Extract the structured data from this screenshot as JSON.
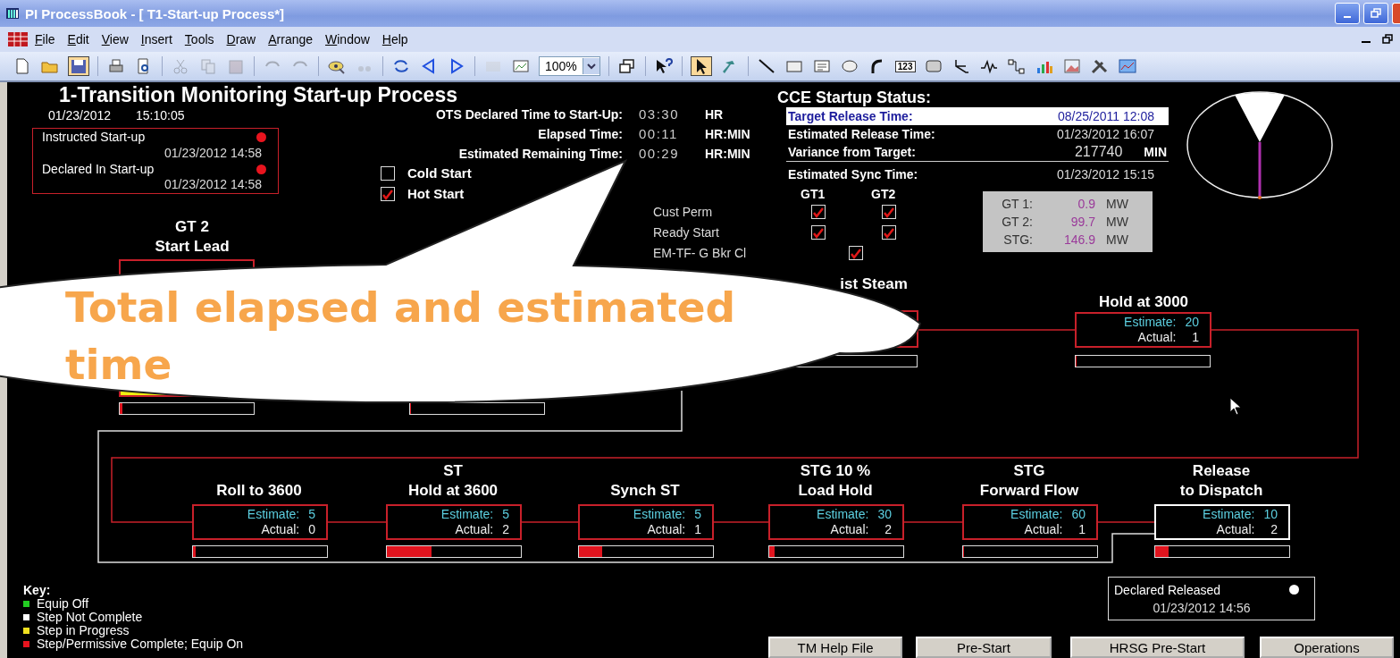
{
  "window": {
    "title": "PI ProcessBook - [ T1-Start-up Process*]"
  },
  "menu": [
    "File",
    "Edit",
    "View",
    "Insert",
    "Tools",
    "Draw",
    "Arrange",
    "Window",
    "Help"
  ],
  "toolbar": {
    "zoom": "100%",
    "number_tool": "123"
  },
  "display": {
    "title": "1-Transition Monitoring Start-up Process",
    "date": "01/23/2012",
    "clock": "15:10:05",
    "events": [
      {
        "label": "Instructed Start-up",
        "time": "01/23/2012 14:58",
        "color": "#e8141e"
      },
      {
        "label": "Declared In Start-up",
        "time": "01/23/2012 14:58",
        "color": "#e8141e"
      }
    ],
    "timings": [
      {
        "label": "OTS Declared Time to Start-Up:",
        "value": "03:30",
        "unit": "HR"
      },
      {
        "label": "Elapsed Time:",
        "value": "00:11",
        "unit": "HR:MIN"
      },
      {
        "label": "Estimated Remaining Time:",
        "value": "00:29",
        "unit": "HR:MIN"
      }
    ],
    "start_modes": [
      {
        "label": "Cold Start",
        "checked": false
      },
      {
        "label": "Hot Start",
        "checked": true
      }
    ],
    "cce": {
      "title": "CCE Startup Status:",
      "rows": [
        {
          "label": "Target Release Time:",
          "value": "08/25/2011 12:08",
          "selected": true
        },
        {
          "label": "Estimated Release Time:",
          "value": "01/23/2012 16:07",
          "selected": false
        },
        {
          "label": "Variance from Target:",
          "value": "217740",
          "unit": "MIN",
          "selected": false
        },
        {
          "label": "Estimated Sync Time:",
          "value": "01/23/2012 15:15",
          "selected": false
        }
      ]
    },
    "permissives": {
      "columns": [
        "GT1",
        "GT2"
      ],
      "rows": [
        {
          "label": "Cust Perm",
          "checks": [
            {
              "checked": true
            },
            {
              "checked": true
            }
          ]
        },
        {
          "label": "Ready Start",
          "checks": [
            {
              "checked": true
            },
            {
              "checked": true
            }
          ]
        },
        {
          "label": "EM-TF- G Bkr Cl",
          "checks": [
            {
              "checked": true
            }
          ]
        }
      ]
    },
    "power": [
      {
        "label": "GT 1:",
        "value": "0.9",
        "unit": "MW"
      },
      {
        "label": "GT 2:",
        "value": "99.7",
        "unit": "MW"
      },
      {
        "label": "STG:",
        "value": "146.9",
        "unit": "MW"
      }
    ],
    "top_steps": [
      {
        "title_lines": [
          "GT 2",
          "Start Lead"
        ],
        "color": "#c8202a",
        "in_progress": true,
        "level": 0.02
      },
      {
        "level": 0
      },
      {
        "title_lines": [
          "ist Steam"
        ],
        "color": "#c8202a",
        "in_progress": false,
        "level": 0
      },
      {
        "title_lines": [
          "Hold at 3000"
        ],
        "color": "#c8202a",
        "in_progress": false,
        "estimate_label": "Estimate:",
        "estimate": "20",
        "actual_label": "Actual:",
        "actual": "1",
        "level": 0
      }
    ],
    "bottom_steps": [
      {
        "title_lines": [
          "Roll to 3600"
        ],
        "color": "#c8202a",
        "in_progress": false,
        "estimate_label": "Estimate:",
        "estimate": "5",
        "actual_label": "Actual:",
        "actual": "0",
        "level": 0.02
      },
      {
        "title_lines": [
          "ST",
          "Hold at 3600"
        ],
        "color": "#c8202a",
        "in_progress": false,
        "estimate_label": "Estimate:",
        "estimate": "5",
        "actual_label": "Actual:",
        "actual": "2",
        "level": 0.33
      },
      {
        "title_lines": [
          "Synch ST"
        ],
        "color": "#c8202a",
        "in_progress": false,
        "estimate_label": "Estimate:",
        "estimate": "5",
        "actual_label": "Actual:",
        "actual": "1",
        "level": 0.17
      },
      {
        "title_lines": [
          "STG 10 %",
          "Load Hold"
        ],
        "color": "#c8202a",
        "in_progress": false,
        "estimate_label": "Estimate:",
        "estimate": "30",
        "actual_label": "Actual:",
        "actual": "2",
        "level": 0.04
      },
      {
        "title_lines": [
          "STG",
          "Forward Flow"
        ],
        "color": "#c8202a",
        "in_progress": false,
        "estimate_label": "Estimate:",
        "estimate": "60",
        "actual_label": "Actual:",
        "actual": "1",
        "level": 0
      },
      {
        "title_lines": [
          "Release",
          "to Dispatch"
        ],
        "color": "#ffffff",
        "in_progress": false,
        "estimate_label": "Estimate:",
        "estimate": "10",
        "actual_label": "Actual:",
        "actual": "2",
        "level": 0.1
      }
    ],
    "declared_release": {
      "label": "Declared Released",
      "time": "01/23/2012 14:56",
      "color": "#ffffff"
    },
    "key": {
      "title": "Key:",
      "items": [
        {
          "label": "Equip Off",
          "color": "#22cc22"
        },
        {
          "label": "Step Not Complete",
          "color": "#ffffff"
        },
        {
          "label": "Step in Progress",
          "color": "#f0e020"
        },
        {
          "label": "Step/Permissive Complete; Equip On",
          "color": "#e8141e"
        }
      ]
    },
    "buttons": [
      "TM Help File",
      "Pre-Start",
      "HRSG Pre-Start",
      "Operations"
    ]
  },
  "callout": {
    "text": "Total elapsed and estimated time"
  }
}
